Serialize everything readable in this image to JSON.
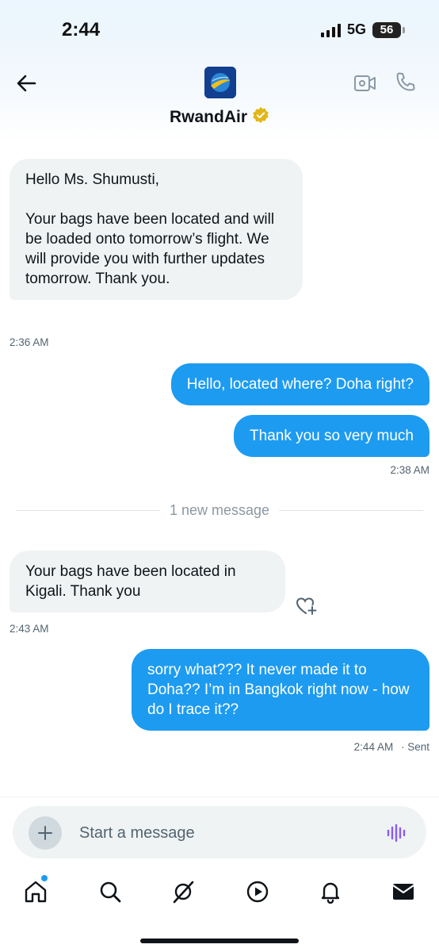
{
  "status_bar": {
    "time": "2:44",
    "network": "5G",
    "battery": "56"
  },
  "header": {
    "contact_name": "RwandAir",
    "verified": true
  },
  "messages": [
    {
      "direction": "in",
      "text": "Hello Ms. Shumusti,\n\nYour bags have been located and will be loaded onto tomorrow’s flight. We will provide you with further updates tomorrow. Thank you."
    },
    {
      "direction": "out",
      "text": "Hello, located where? Doha right?"
    },
    {
      "direction": "out",
      "text": "Thank you so very much"
    },
    {
      "direction": "in",
      "text": "Your bags have been located in Kigali. Thank you"
    },
    {
      "direction": "out",
      "text": "sorry what??? It never made it to Doha?? I’m in Bangkok right now - how do I trace it??"
    }
  ],
  "timestamps": {
    "t1": "2:36 AM",
    "t2": "2:38 AM",
    "t3": "2:43 AM",
    "t4": "2:44 AM",
    "t4_status": "· Sent"
  },
  "divider_text": "1 new message",
  "composer": {
    "placeholder": "Start a message"
  },
  "colors": {
    "accent": "#1d9bf0",
    "incoming_bubble": "#eff3f4",
    "verified_badge": "#e2b719",
    "voice_icon": "#8b5cf6"
  },
  "icons": {
    "header": [
      "back-arrow-icon",
      "video-call-icon",
      "phone-icon"
    ],
    "bottom_nav": [
      "home-icon",
      "search-icon",
      "grok-icon",
      "video-play-icon",
      "bell-icon",
      "mail-icon"
    ]
  }
}
